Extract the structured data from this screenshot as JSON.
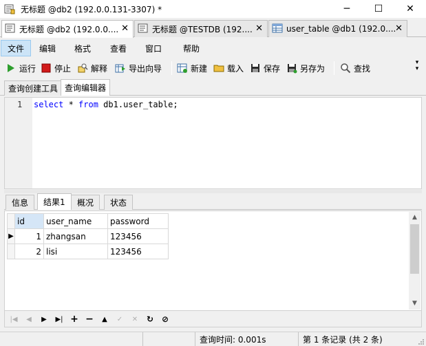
{
  "window": {
    "title": "无标题 @db2 (192.0.0.131-3307) *",
    "minimize": "─",
    "maximize": "☐",
    "close": "✕"
  },
  "doc_tabs": [
    {
      "label": "无标题 @db2 (192.0.0....",
      "close": "✕"
    },
    {
      "label": "无标题 @TESTDB (192....",
      "close": "✕"
    },
    {
      "label": "user_table @db1 (192.0....",
      "close": "✕"
    }
  ],
  "menu": [
    "文件",
    "编辑",
    "格式",
    "查看",
    "窗口",
    "帮助"
  ],
  "toolbar": {
    "run": "运行",
    "stop": "停止",
    "explain": "解释",
    "export_wizard": "导出向导",
    "new": "新建",
    "load": "载入",
    "save": "保存",
    "save_as": "另存为",
    "find": "查找"
  },
  "sub_tabs": [
    "查询创建工具",
    "查询编辑器"
  ],
  "editor": {
    "line_number": "1",
    "tokens": {
      "select": "select",
      "star": " * ",
      "from": "from",
      "rest": " db1.user_table;"
    }
  },
  "result_tabs": [
    "信息",
    "结果1",
    "概况",
    "状态"
  ],
  "grid": {
    "columns": [
      "id",
      "user_name",
      "password"
    ],
    "rows": [
      {
        "id": "1",
        "user_name": "zhangsan",
        "password": "123456"
      },
      {
        "id": "2",
        "user_name": "lisi",
        "password": "123456"
      }
    ],
    "current_row_marker": "▶"
  },
  "status": {
    "query_time": "查询时间: 0.001s",
    "records": "第 1 条记录 (共 2 条)"
  }
}
